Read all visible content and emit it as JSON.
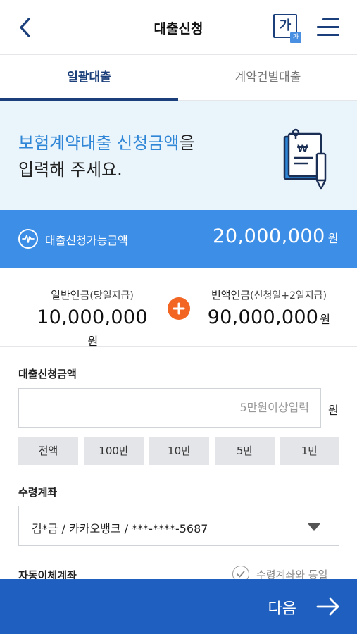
{
  "header": {
    "title": "대출신청",
    "font_size_big": "가",
    "font_size_small": "가"
  },
  "tabs": [
    {
      "label": "일괄대출",
      "active": true
    },
    {
      "label": "계약건별대출",
      "active": false
    }
  ],
  "intro": {
    "highlight": "보험계약대출 신청금액",
    "rest_line1": "을",
    "line2": "입력해 주세요."
  },
  "limit": {
    "label": "대출신청가능금액",
    "value": "20,000,000",
    "unit": "원"
  },
  "split": {
    "left": {
      "label": "일반연금",
      "sub": "(당일지급)",
      "amount": "10,000,000",
      "unit": "원"
    },
    "right": {
      "label": "변액연금",
      "sub": "(신청일+2일지급)",
      "amount": "90,000,000",
      "unit": "원"
    }
  },
  "loan_amount": {
    "label": "대출신청금액",
    "placeholder": "5만원이상입력",
    "unit": "원",
    "quick_buttons": [
      "전액",
      "100만",
      "10만",
      "5만",
      "1만"
    ]
  },
  "receive_account": {
    "label": "수령계좌",
    "value": "김*금 / 카카오뱅크 / ***-****-5687"
  },
  "auto_transfer": {
    "label": "자동이체계좌",
    "same_as_label": "수령계좌와 동일"
  },
  "next_button": {
    "label": "다음"
  },
  "colors": {
    "brand_navy": "#1b3f7a",
    "accent_blue": "#3d8ee6",
    "intro_bg": "#eaf4fb",
    "plus_orange": "#f26522",
    "next_bar": "#1f5fbf"
  }
}
